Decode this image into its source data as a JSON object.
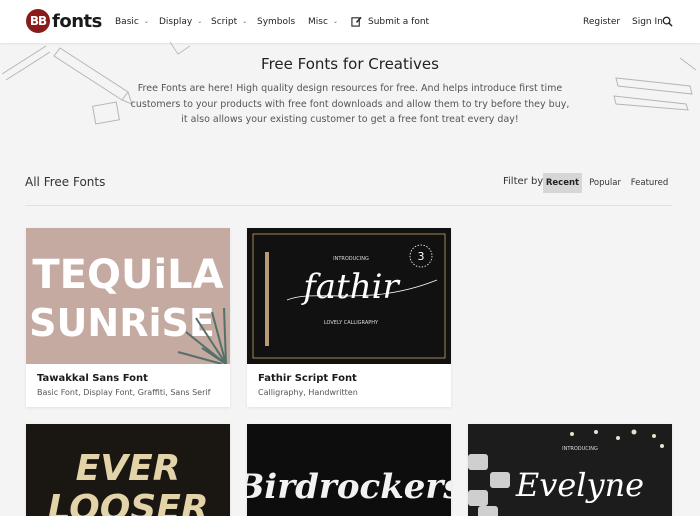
{
  "header": {
    "logo_badge": "BB",
    "logo_text": "fonts",
    "nav": [
      {
        "label": "Basic",
        "has_dropdown": true
      },
      {
        "label": "Display",
        "has_dropdown": true
      },
      {
        "label": "Script",
        "has_dropdown": true
      },
      {
        "label": "Symbols",
        "has_dropdown": false
      },
      {
        "label": "Misc",
        "has_dropdown": true
      }
    ],
    "submit_label": "Submit a font",
    "register_label": "Register",
    "signin_label": "Sign In",
    "chevron": "⌄",
    "icons": {
      "submit": "pen-icon",
      "search": "search-icon"
    }
  },
  "hero": {
    "title": "Free Fonts for Creatives",
    "description": "Free Fonts are here! High quality design resources for free. And helps introduce first time customers to your products with free font downloads and allow them to try before they buy, it also allows your existing customer to get a free font treat every day!"
  },
  "listing": {
    "section_title": "All Free Fonts",
    "filter_label": "Filter by:",
    "filters": [
      {
        "label": "Recent",
        "active": true
      },
      {
        "label": "Popular",
        "active": false
      },
      {
        "label": "Featured",
        "active": false
      }
    ]
  },
  "cards": [
    {
      "name": "Tawakkal Sans Font",
      "tags": "Basic Font, Display Font, Graffiti, Sans Serif",
      "preview_lines": [
        "TEQUiLA",
        "SUNRiSE"
      ]
    },
    {
      "name": "Fathir Script Font",
      "tags": "Calligraphy, Handwritten",
      "preview_top": "INTRODUCING",
      "preview_main": "fathir",
      "preview_sub": "LOVELY CALLIGRAPHY",
      "preview_badge": "3"
    },
    {
      "preview_lines": [
        "EVER",
        "LOOSER"
      ]
    },
    {
      "preview_main": "Birdrockers"
    },
    {
      "preview_main": "Evelyne",
      "preview_top": "INTRODUCING"
    }
  ],
  "colors": {
    "brand": "#8b1a1a",
    "card1_bg": "#c4aaa1",
    "dark_preview": "#111111",
    "gold": "#c9a46b",
    "active_filter": "#d6d6d6"
  }
}
